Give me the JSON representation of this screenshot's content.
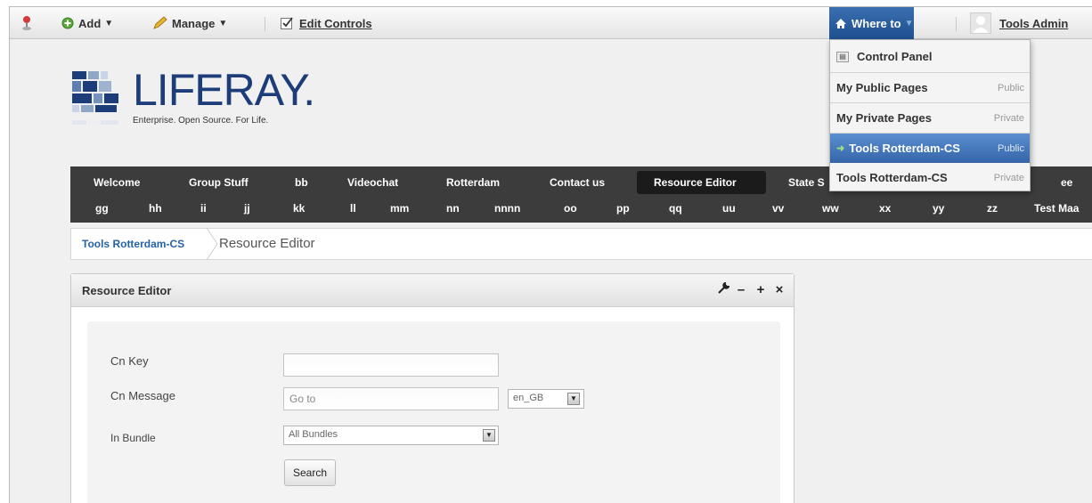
{
  "dockbar": {
    "add_label": "Add",
    "manage_label": "Manage",
    "edit_controls_label": "Edit Controls",
    "where_to_label": "Where to",
    "user_name": "Tools Admin"
  },
  "where_to_menu": {
    "items": [
      {
        "label": "Control Panel",
        "tag": ""
      },
      {
        "label": "My Public Pages",
        "tag": "Public"
      },
      {
        "label": "My Private Pages",
        "tag": "Private"
      },
      {
        "label": "Tools Rotterdam-CS",
        "tag": "Public"
      },
      {
        "label": "Tools Rotterdam-CS",
        "tag": "Private"
      }
    ]
  },
  "logo": {
    "word": "LIFERAY.",
    "tagline": "Enterprise. Open Source. For Life."
  },
  "nav": {
    "row1": [
      "Welcome",
      "Group Stuff",
      "bb",
      "Videochat",
      "Rotterdam",
      "Contact us",
      "Resource Editor",
      "State S",
      "ee"
    ],
    "row2": [
      "gg",
      "hh",
      "ii",
      "jj",
      "kk",
      "ll",
      "mm",
      "nn",
      "nnnn",
      "oo",
      "pp",
      "qq",
      "uu",
      "vv",
      "ww",
      "xx",
      "yy",
      "zz",
      "Test Maa"
    ],
    "selected": "Resource Editor"
  },
  "breadcrumb": {
    "site": "Tools Rotterdam-CS",
    "page": "Resource Editor"
  },
  "portlet": {
    "title": "Resource Editor",
    "form": {
      "key_label": "Cn Key",
      "key_value": "",
      "message_label": "Cn Message",
      "message_value": "Go to",
      "locale_value": "en_GB",
      "bundle_label": "In Bundle",
      "bundle_value": "All Bundles",
      "search_label": "Search"
    }
  },
  "colors": {
    "accent": "#2563a8",
    "nav_bg": "#3c3c3c",
    "dropdown_active": "#3465a8"
  }
}
